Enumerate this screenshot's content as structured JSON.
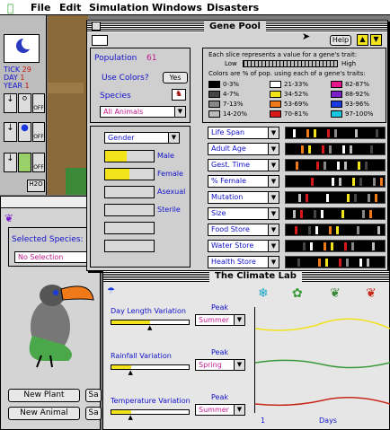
{
  "menu": {
    "apple": "",
    "file": "File",
    "edit": "Edit",
    "simulation": "Simulation",
    "windows": "Windows",
    "disasters": "Disasters"
  },
  "status": {
    "tick_label": "TICK",
    "tick": "29",
    "day_label": "DAY",
    "day": "1",
    "year_label": "YEAR",
    "year": "1"
  },
  "side_labels": {
    "off1": "OFF",
    "off2": "OFF",
    "off3": "OFF",
    "h2o": "H2O"
  },
  "species_window": {
    "selected_label": "Selected Species:",
    "selection": "No Selection"
  },
  "buttons": {
    "new_plant": "New Plant",
    "new_animal": "New Animal",
    "s1": "Sa",
    "s2": "Sa"
  },
  "gene_pool": {
    "title": "Gene Pool",
    "help": "Help",
    "population_label": "Population",
    "population": "61",
    "use_colors": "Use Colors?",
    "yes": "Yes",
    "species_label": "Species",
    "species_value": "All Animals",
    "gender_value": "Gender",
    "gender_rows": [
      {
        "label": "Male",
        "fill": 0.45
      },
      {
        "label": "Female",
        "fill": 0.5
      },
      {
        "label": "Asexual",
        "fill": 0
      },
      {
        "label": "Sterile",
        "fill": 0
      },
      {
        "label": "",
        "fill": 0
      },
      {
        "label": "",
        "fill": 0
      }
    ],
    "info1": "Each slice represents a value for a gene's trait:",
    "low": "Low",
    "high": "High",
    "info2": "Colors are % of pop. using each of a gene's traits:",
    "legend": [
      {
        "label": "0-3%",
        "color": "#000000"
      },
      {
        "label": "21-33%",
        "color": "#ffffff"
      },
      {
        "label": "82-87%",
        "color": "#e8148c"
      },
      {
        "label": "4-7%",
        "color": "#444444"
      },
      {
        "label": "34-52%",
        "color": "#f2e31a"
      },
      {
        "label": "88-92%",
        "color": "#7a1ec8"
      },
      {
        "label": "7-13%",
        "color": "#888888"
      },
      {
        "label": "53-69%",
        "color": "#f07a1a"
      },
      {
        "label": "93-96%",
        "color": "#1a3ae0"
      },
      {
        "label": "14-20%",
        "color": "#bbbbbb"
      },
      {
        "label": "70-81%",
        "color": "#d81818"
      },
      {
        "label": "97-100%",
        "color": "#18c8e0"
      }
    ],
    "traits": [
      "Life Span",
      "Adult Age",
      "Gest. Time",
      "% Female",
      "Mutation",
      "Size",
      "Food Store",
      "Water Store",
      "Health Store"
    ]
  },
  "climate": {
    "title": "The Climate Lab",
    "peak": "Peak",
    "rows": [
      {
        "label": "Day Length Variation",
        "season": "Summer",
        "level": 0.5
      },
      {
        "label": "Rainfall Variation",
        "season": "Spring",
        "level": 0.25
      },
      {
        "label": "Temperature Variation",
        "season": "Summer",
        "level": 0.25
      }
    ],
    "x_start": "1",
    "x_label": "Days"
  },
  "colors": {
    "title_blue": "#1111cc",
    "value_red": "#cc1111",
    "value_magenta": "#c01890"
  }
}
